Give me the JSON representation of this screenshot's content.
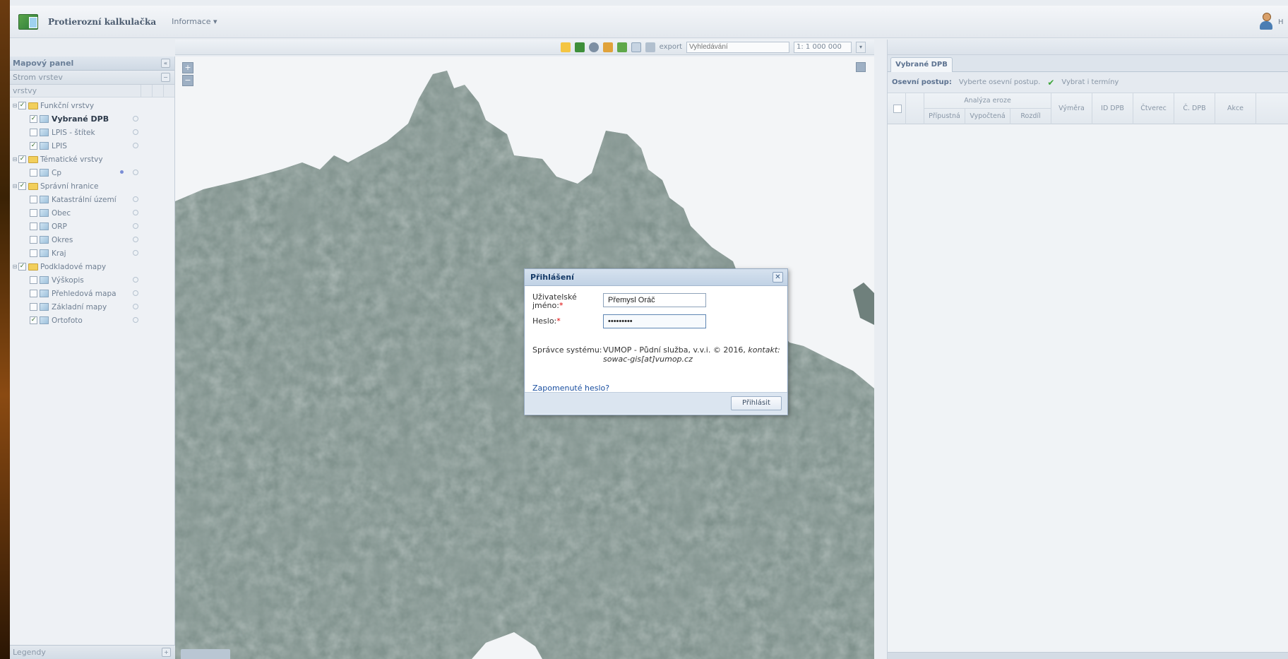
{
  "header": {
    "title": "Protierozní kalkulačka",
    "menu_info": "Informace ▾",
    "user_name": "H"
  },
  "left_panel": {
    "title": "Mapový panel",
    "subtitle": "Strom vrstev",
    "column_header": "vrstvy",
    "legend_footer": "Legendy",
    "tree": [
      {
        "label": "Funkční vrstvy",
        "level": 0,
        "type": "folder",
        "checked": true,
        "expanded": true
      },
      {
        "label": "Vybrané DPB",
        "level": 1,
        "type": "layer",
        "checked": true,
        "bold": true
      },
      {
        "label": "LPIS - štítek",
        "level": 1,
        "type": "layer",
        "checked": false
      },
      {
        "label": "LPIS",
        "level": 1,
        "type": "layer",
        "checked": true
      },
      {
        "label": "Tématické vrstvy",
        "level": 0,
        "type": "folder",
        "checked": true,
        "expanded": true
      },
      {
        "label": "Cp",
        "level": 1,
        "type": "layer",
        "checked": false,
        "legend": true
      },
      {
        "label": "Správní hranice",
        "level": 0,
        "type": "folder",
        "checked": true,
        "expanded": true
      },
      {
        "label": "Katastrální území",
        "level": 1,
        "type": "layer",
        "checked": false
      },
      {
        "label": "Obec",
        "level": 1,
        "type": "layer",
        "checked": false
      },
      {
        "label": "ORP",
        "level": 1,
        "type": "layer",
        "checked": false
      },
      {
        "label": "Okres",
        "level": 1,
        "type": "layer",
        "checked": false
      },
      {
        "label": "Kraj",
        "level": 1,
        "type": "layer",
        "checked": false
      },
      {
        "label": "Podkladové mapy",
        "level": 0,
        "type": "folder",
        "checked": true,
        "expanded": true
      },
      {
        "label": "Výškopis",
        "level": 1,
        "type": "layer",
        "checked": false
      },
      {
        "label": "Přehledová mapa",
        "level": 1,
        "type": "layer",
        "checked": false
      },
      {
        "label": "Základní mapy",
        "level": 1,
        "type": "layer",
        "checked": false
      },
      {
        "label": "Ortofoto",
        "level": 1,
        "type": "layer",
        "checked": true
      }
    ]
  },
  "toolbar": {
    "export_label": "export",
    "search_placeholder": "Vyhledávání",
    "scale_value": "1: 1 000 000"
  },
  "map": {
    "zoom_in": "+",
    "zoom_out": "−"
  },
  "login_dialog": {
    "title": "Přihlášení",
    "username_label": "Uživatelské jméno:",
    "username_value": "Přemysl Oráč",
    "password_label": "Heslo:",
    "password_value": "•••••••••",
    "admin_label": "Správce systému:",
    "admin_text": "VUMOP - Půdní služba, v.v.i. © 2016,",
    "admin_contact_label": "kontakt:",
    "admin_contact": "sowac-gis[at]vumop.cz",
    "forgot_link": "Zapomenuté heslo?",
    "login_button": "Přihlásit"
  },
  "right_panel": {
    "tab": "Vybrané DPB",
    "procedure_label": "Osevní postup:",
    "procedure_select": "Vyberte osevní postup.",
    "procedure_action": "Vybrat i termíny",
    "table": {
      "group_header": "Analýza eroze",
      "sub_headers": [
        "Přípustná",
        "Vypočtená",
        "Rozdíl"
      ],
      "headers": [
        "Výměra",
        "ID DPB",
        "Čtverec",
        "Č. DPB",
        "Akce"
      ]
    }
  },
  "colors": {
    "accent": "#153a67",
    "link": "#1a4fa0",
    "panel_bg": "#eef1f5",
    "check_green": "#3da53a"
  }
}
